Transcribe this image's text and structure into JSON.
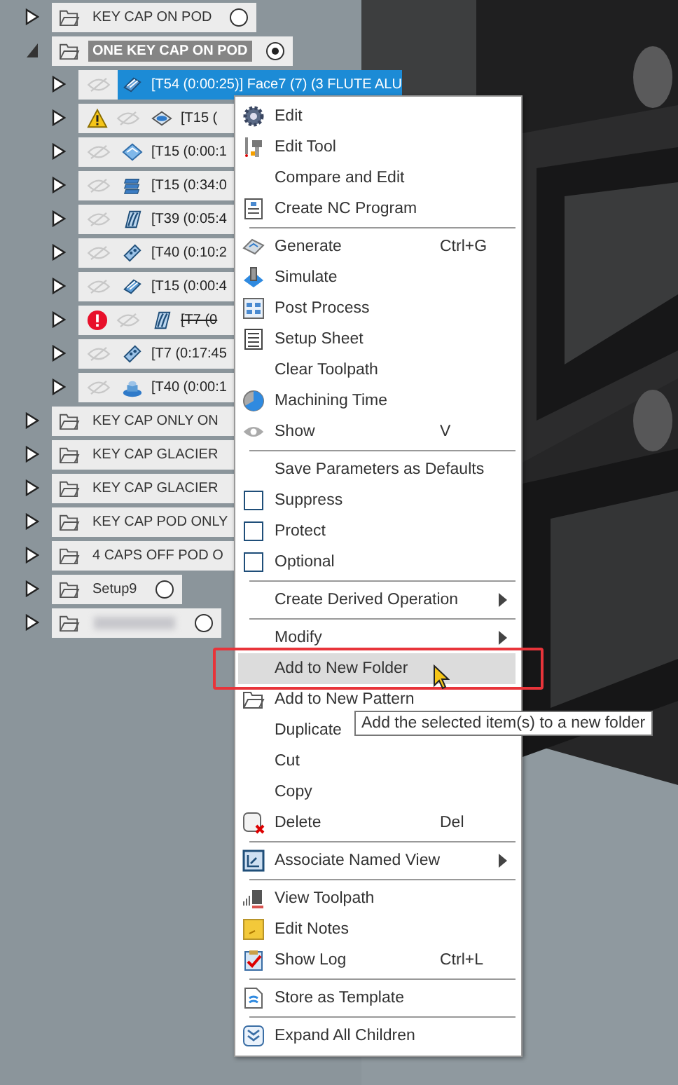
{
  "tree": {
    "setups": [
      {
        "label": "KEY CAP ON POD",
        "kind": "radio",
        "selected": false,
        "expanded": false,
        "active": false
      },
      {
        "label": "ONE KEY CAP ON POD",
        "kind": "radio",
        "selected": true,
        "expanded": true,
        "active": true,
        "children": [
          {
            "label": "[T54 (0:00:25)] Face7 (7) (3 FLUTE ALU",
            "kind": "stack",
            "selected": true,
            "warning": false,
            "error": false,
            "invalid": false
          },
          {
            "label": "[T15 (",
            "kind": "dish",
            "selected": false,
            "warning": true,
            "error": false,
            "invalid": false
          },
          {
            "label": "[T15 (0:00:1",
            "kind": "diamond",
            "selected": false,
            "warning": false,
            "error": false,
            "invalid": false
          },
          {
            "label": "[T15 (0:34:0",
            "kind": "layers",
            "selected": false,
            "warning": false,
            "error": false,
            "invalid": false
          },
          {
            "label": "[T39 (0:05:4",
            "kind": "flow",
            "selected": false,
            "warning": false,
            "error": false,
            "invalid": false
          },
          {
            "label": "[T40 (0:10:2",
            "kind": "drill",
            "selected": false,
            "warning": false,
            "error": false,
            "invalid": false
          },
          {
            "label": "[T15 (0:00:4",
            "kind": "stack",
            "selected": false,
            "warning": false,
            "error": false,
            "invalid": false
          },
          {
            "label": "[T7 (0",
            "kind": "flow",
            "selected": false,
            "warning": false,
            "error": true,
            "invalid": true
          },
          {
            "label": "[T7 (0:17:45",
            "kind": "drill",
            "selected": false,
            "warning": false,
            "error": false,
            "invalid": false
          },
          {
            "label": "[T40 (0:00:1",
            "kind": "bore",
            "selected": false,
            "warning": false,
            "error": false,
            "invalid": false
          }
        ]
      },
      {
        "label": "KEY CAP ONLY ON",
        "kind": "plain",
        "expanded": false,
        "active": false
      },
      {
        "label": "KEY CAP GLACIER",
        "kind": "plain",
        "expanded": false,
        "active": false
      },
      {
        "label": "KEY CAP GLACIER",
        "kind": "plain",
        "expanded": false,
        "active": false
      },
      {
        "label": "KEY CAP POD ONLY",
        "kind": "plain",
        "expanded": false,
        "active": false
      },
      {
        "label": "4 CAPS OFF POD O",
        "kind": "plain",
        "expanded": false,
        "active": false
      },
      {
        "label": "Setup9",
        "kind": "radio",
        "selected": false,
        "expanded": false,
        "active": false
      },
      {
        "kind": "radio",
        "redacted": true,
        "selected": false,
        "expanded": false,
        "active": false
      }
    ]
  },
  "menu": {
    "groups": [
      [
        {
          "label": "Edit",
          "kind": "gear",
          "selected": false
        },
        {
          "label": "Edit Tool",
          "kind": "tool",
          "selected": false
        },
        {
          "label": "Compare and Edit",
          "kind": "plain",
          "selected": false
        },
        {
          "label": "Create NC Program",
          "kind": "nc",
          "selected": false
        }
      ],
      [
        {
          "label": "Generate",
          "kind": "generate",
          "shortcut": "Ctrl+G",
          "selected": false
        },
        {
          "label": "Simulate",
          "kind": "simulate",
          "selected": false
        },
        {
          "label": "Post Process",
          "kind": "post",
          "selected": false
        },
        {
          "label": "Setup Sheet",
          "kind": "sheet",
          "selected": false
        },
        {
          "label": "Clear Toolpath",
          "kind": "plain",
          "selected": false
        },
        {
          "label": "Machining Time",
          "kind": "pie",
          "selected": false
        },
        {
          "label": "Show",
          "kind": "eye",
          "shortcut": "V",
          "selected": false
        }
      ],
      [
        {
          "label": "Save Parameters as Defaults",
          "kind": "plain",
          "selected": false
        },
        {
          "label": "Suppress",
          "kind": "checkbox",
          "checked": false,
          "selected": false
        },
        {
          "label": "Protect",
          "kind": "checkbox",
          "checked": false,
          "selected": false
        },
        {
          "label": "Optional",
          "kind": "checkbox",
          "checked": false,
          "selected": false
        }
      ],
      [
        {
          "label": "Create Derived Operation",
          "kind": "plain",
          "submenu": true,
          "selected": false
        }
      ],
      [
        {
          "label": "Modify",
          "kind": "plain",
          "submenu": true,
          "selected": false
        },
        {
          "label": "Add to New Folder",
          "kind": "plain",
          "selected": true
        },
        {
          "label": "Add to New Pattern",
          "kind": "folder",
          "selected": false
        },
        {
          "label": "Duplicate",
          "kind": "plain",
          "selected": false
        },
        {
          "label": "Cut",
          "kind": "plain",
          "selected": false
        },
        {
          "label": "Copy",
          "kind": "plain",
          "selected": false
        },
        {
          "label": "Delete",
          "kind": "delete",
          "shortcut": "Del",
          "selected": false
        }
      ],
      [
        {
          "label": "Associate Named View",
          "kind": "view",
          "submenu": true,
          "selected": false
        }
      ],
      [
        {
          "label": "View Toolpath",
          "kind": "toolpath",
          "selected": false
        },
        {
          "label": "Edit Notes",
          "kind": "note",
          "selected": false
        },
        {
          "label": "Show Log",
          "kind": "log",
          "shortcut": "Ctrl+L",
          "selected": false
        }
      ],
      [
        {
          "label": "Store as Template",
          "kind": "template",
          "selected": false
        }
      ],
      [
        {
          "label": "Expand All Children",
          "kind": "expand",
          "selected": false
        }
      ]
    ]
  },
  "tooltip": {
    "text": "Add the selected item(s) to a new folder"
  }
}
